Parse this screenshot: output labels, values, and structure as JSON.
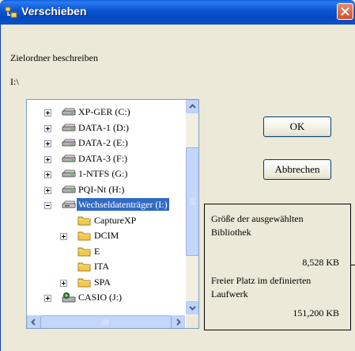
{
  "window": {
    "title": "Verschieben"
  },
  "dialog": {
    "description": "Zielordner beschreiben",
    "current_path": "I:\\"
  },
  "tree": {
    "items": [
      {
        "label": "XP-GER (C:)",
        "icon": "drive-icon",
        "expander": "plus",
        "level": 0
      },
      {
        "label": "DATA-1 (D:)",
        "icon": "drive-icon",
        "expander": "plus",
        "level": 0
      },
      {
        "label": "DATA-2 (E:)",
        "icon": "drive-icon",
        "expander": "plus",
        "level": 0
      },
      {
        "label": "DATA-3 (F:)",
        "icon": "drive-icon",
        "expander": "plus",
        "level": 0
      },
      {
        "label": "1-NTFS (G:)",
        "icon": "drive-icon",
        "expander": "plus",
        "level": 0
      },
      {
        "label": "PQI-Nt (H:)",
        "icon": "drive-icon",
        "expander": "plus",
        "level": 0
      },
      {
        "label": "Wechseldatenträger (I:)",
        "icon": "removable-drive-icon",
        "expander": "minus",
        "level": 0,
        "selected": true
      },
      {
        "label": "CaptureXP",
        "icon": "folder-icon",
        "expander": "none",
        "level": 1
      },
      {
        "label": "DCIM",
        "icon": "folder-icon",
        "expander": "plus",
        "level": 1
      },
      {
        "label": "E",
        "icon": "folder-icon",
        "expander": "none",
        "level": 1
      },
      {
        "label": "ITA",
        "icon": "folder-icon",
        "expander": "none",
        "level": 1
      },
      {
        "label": "SPA",
        "icon": "folder-icon",
        "expander": "plus",
        "level": 1
      },
      {
        "label": "CASIO (J:)",
        "icon": "camera-drive-icon",
        "expander": "plus",
        "level": 0
      }
    ]
  },
  "buttons": {
    "ok": "OK",
    "cancel": "Abbrechen"
  },
  "info": {
    "selected_size_label_1": "Größe der ausgewählten",
    "selected_size_label_2": "Bibliothek",
    "selected_size_value": "8,528  KB",
    "free_space_label_1": "Freier Platz im definierten",
    "free_space_label_2": "Laufwerk",
    "free_space_value": "151,200  KB"
  },
  "colors": {
    "title_bar": "#0a58d3",
    "selection": "#316ac5",
    "close_button": "#d0502c"
  }
}
